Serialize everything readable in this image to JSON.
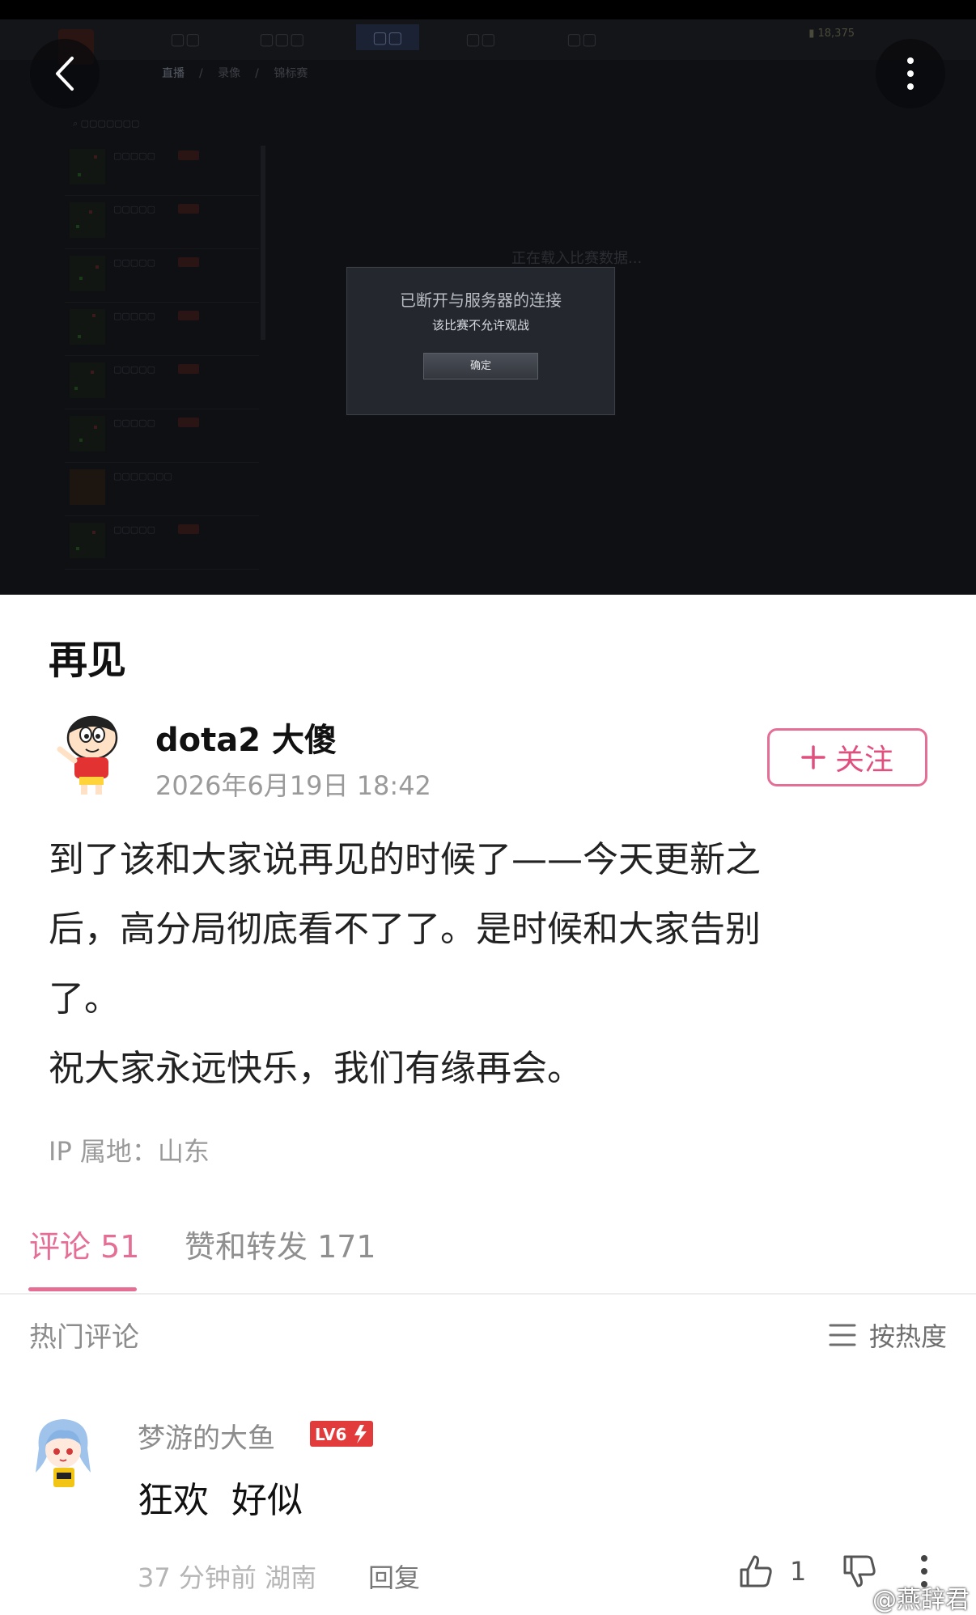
{
  "screenshot": {
    "nav_tabs": [
      "直播",
      "录像",
      "锦标赛"
    ],
    "dialog": {
      "title": "已断开与服务器的连接",
      "message": "该比赛不允许观战",
      "confirm_label": "确定"
    },
    "loading_text": "正在载入比赛数据..."
  },
  "header": {
    "back_icon": "chevron-left-icon",
    "more_icon": "more-vertical-icon"
  },
  "post": {
    "title": "再见",
    "author": "dota2 大傻",
    "date": "2026年6月19日 18:42",
    "follow_label": "关注",
    "body": "到了该和大家说再见的时候了——今天更新之\n后，高分局彻底看不了了。是时候和大家告别\n了。\n祝大家永远快乐，我们有缘再会。",
    "ip_location": "IP 属地：山东"
  },
  "tabs": {
    "comments": "评论 51",
    "likes_reposts": "赞和转发 171"
  },
  "comments_header": {
    "hot_label": "热门评论",
    "sort_label": "按热度"
  },
  "comments": [
    {
      "user": "梦游的大鱼",
      "level_badge": "LV6",
      "text": "狂欢  好似",
      "meta": "37 分钟前  湖南",
      "reply_label": "回复",
      "like_count": "1"
    }
  ],
  "watermark": "@燕辞君",
  "colors": {
    "accent": "#e56e95",
    "level_badge": "#e23b3b",
    "muted": "#9a9a9a"
  }
}
